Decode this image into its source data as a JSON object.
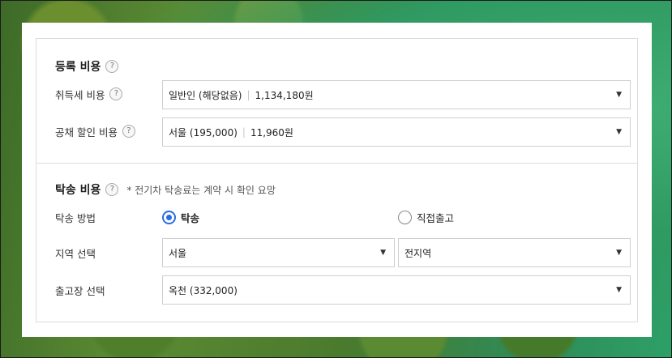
{
  "registration": {
    "title": "등록 비용",
    "help": "?",
    "acquisition_tax": {
      "label": "취득세 비용",
      "selected": "일반인 (해당없음)",
      "amount": "1,134,180원"
    },
    "bond_discount": {
      "label": "공채 할인 비용",
      "selected": "서울 (195,000)",
      "amount": "11,960원"
    }
  },
  "delivery": {
    "title": "탁송 비용",
    "help": "?",
    "note": "* 전기차 탁송료는 계약 시 확인 요망",
    "method": {
      "label": "탁송 방법",
      "options": [
        "탁송",
        "직접출고"
      ],
      "selected": "탁송"
    },
    "region": {
      "label": "지역 선택",
      "selected": "서울",
      "sub_selected": "전지역"
    },
    "depot": {
      "label": "출고장 선택",
      "selected": "옥천 (332,000)"
    }
  },
  "icons": {
    "dropdown": "▼"
  },
  "colors": {
    "accent": "#2b6de0"
  }
}
